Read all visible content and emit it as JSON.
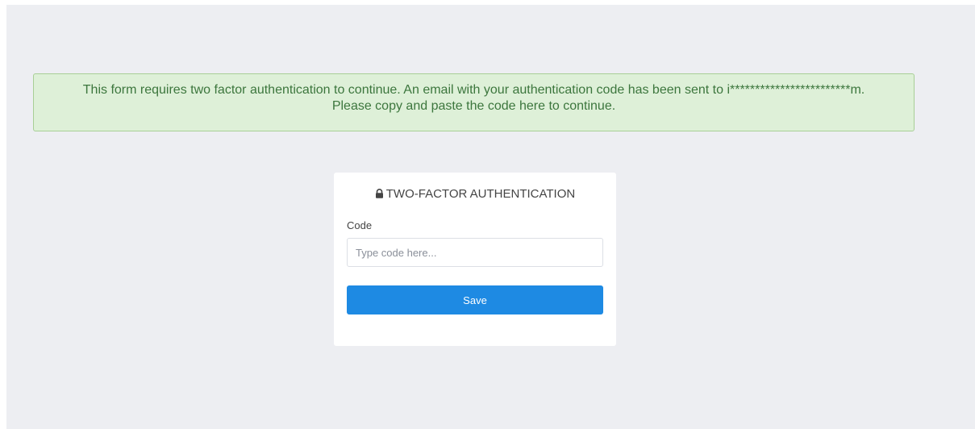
{
  "alert": {
    "line1": "This form requires two factor authentication to continue. An email with your authentication code has been sent to i************************m.",
    "line2": "Please copy and paste the code here to continue."
  },
  "card": {
    "title": "TWO-FACTOR AUTHENTICATION",
    "title_icon": "lock-icon",
    "code_label": "Code",
    "code_value": "",
    "code_placeholder": "Type code here...",
    "save_label": "Save"
  },
  "colors": {
    "page_background": "#edeef2",
    "alert_background": "#def0d8",
    "alert_text": "#3c763d",
    "alert_border": "#a8cf96",
    "primary_button": "#1e8ae3"
  }
}
